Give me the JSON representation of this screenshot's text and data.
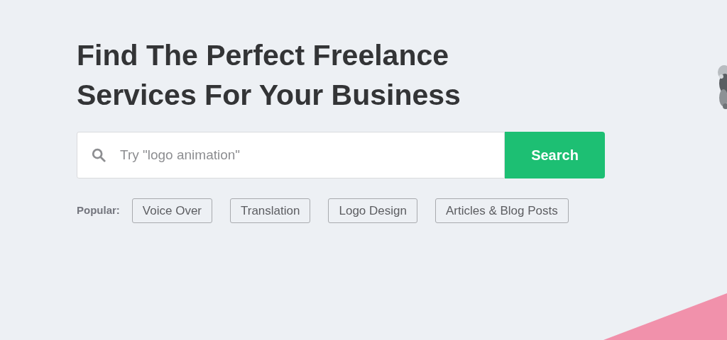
{
  "hero": {
    "heading": "Find The Perfect Freelance\nServices For Your Business",
    "search": {
      "placeholder": "Try \"logo animation\"",
      "button": "Search"
    },
    "popular": {
      "label": "Popular:",
      "tags": [
        "Voice Over",
        "Translation",
        "Logo Design",
        "Articles & Blog Posts"
      ]
    }
  }
}
